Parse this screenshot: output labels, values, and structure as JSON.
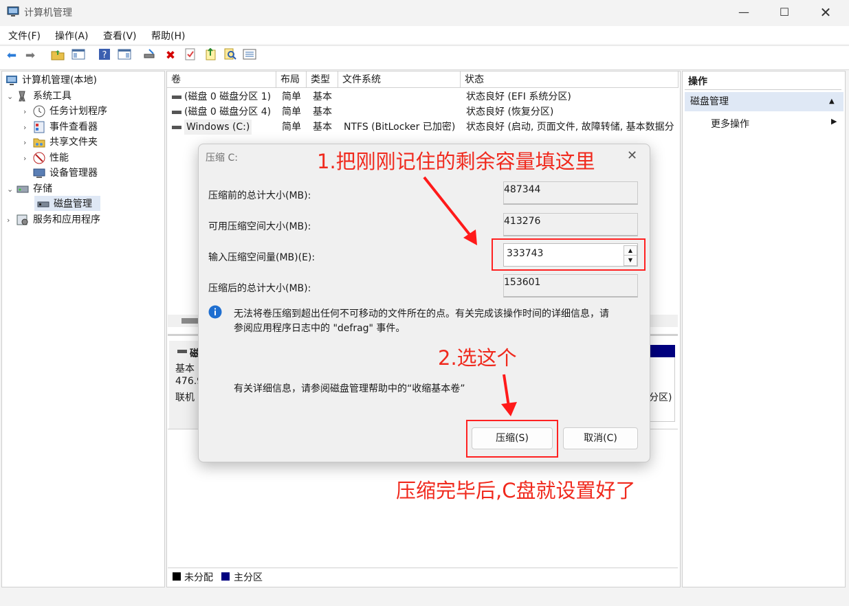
{
  "window": {
    "title": "计算机管理"
  },
  "window_controls": {
    "minimize": "—",
    "maximize": "☐",
    "close": "✕"
  },
  "menu": [
    "文件(F)",
    "操作(A)",
    "查看(V)",
    "帮助(H)"
  ],
  "tree": {
    "root": "计算机管理(本地)",
    "system_tools": "系统工具",
    "task_scheduler": "任务计划程序",
    "event_viewer": "事件查看器",
    "shared_folders": "共享文件夹",
    "performance": "性能",
    "device_manager": "设备管理器",
    "storage": "存储",
    "disk_management": "磁盘管理",
    "services": "服务和应用程序"
  },
  "volume_table": {
    "headers": [
      "卷",
      "布局",
      "类型",
      "文件系统",
      "状态"
    ],
    "rows": [
      {
        "volume": "(磁盘 0 磁盘分区 1)",
        "layout": "简单",
        "type": "基本",
        "fs": "",
        "status": "状态良好 (EFI 系统分区)"
      },
      {
        "volume": "(磁盘 0 磁盘分区 4)",
        "layout": "简单",
        "type": "基本",
        "fs": "",
        "status": "状态良好 (恢复分区)"
      },
      {
        "volume": "Windows (C:)",
        "layout": "简单",
        "type": "基本",
        "fs": "NTFS (BitLocker 已加密)",
        "status": "状态良好 (启动, 页面文件, 故障转储, 基本数据分"
      }
    ]
  },
  "disk_map": {
    "disk_name": "磁",
    "disk_type": "基本",
    "disk_size": "476.9",
    "disk_status": "联机",
    "partition_fragment": "分区)",
    "legend": {
      "unallocated": "未分配",
      "primary": "主分区"
    }
  },
  "actions": {
    "header": "操作",
    "section": "磁盘管理",
    "more": "更多操作"
  },
  "dialog": {
    "title": "压缩 C:",
    "total_before_label": "压缩前的总计大小(MB):",
    "total_before_value": "487344",
    "available_label": "可用压缩空间大小(MB):",
    "available_value": "413276",
    "input_label": "输入压缩空间量(MB)(E):",
    "input_value": "333743",
    "total_after_label": "压缩后的总计大小(MB):",
    "total_after_value": "153601",
    "info_text_1": "无法将卷压缩到超出任何不可移动的文件所在的点。有关完成该操作时间的详细信息，请",
    "info_text_2": "参阅应用程序日志中的 \"defrag\" 事件。",
    "help_text": "有关详细信息，请参阅磁盘管理帮助中的“收缩基本卷”",
    "shrink_button": "压缩(S)",
    "cancel_button": "取消(C)"
  },
  "annotations": {
    "step1": "1.把刚刚记住的剩余容量填这里",
    "step2": "2.选这个",
    "done": "压缩完毕后,C盘就设置好了"
  },
  "colors": {
    "annotation": "#f0291d",
    "primary_partition": "#00007f",
    "unallocated": "#000000",
    "selection": "#dfe8f5"
  }
}
